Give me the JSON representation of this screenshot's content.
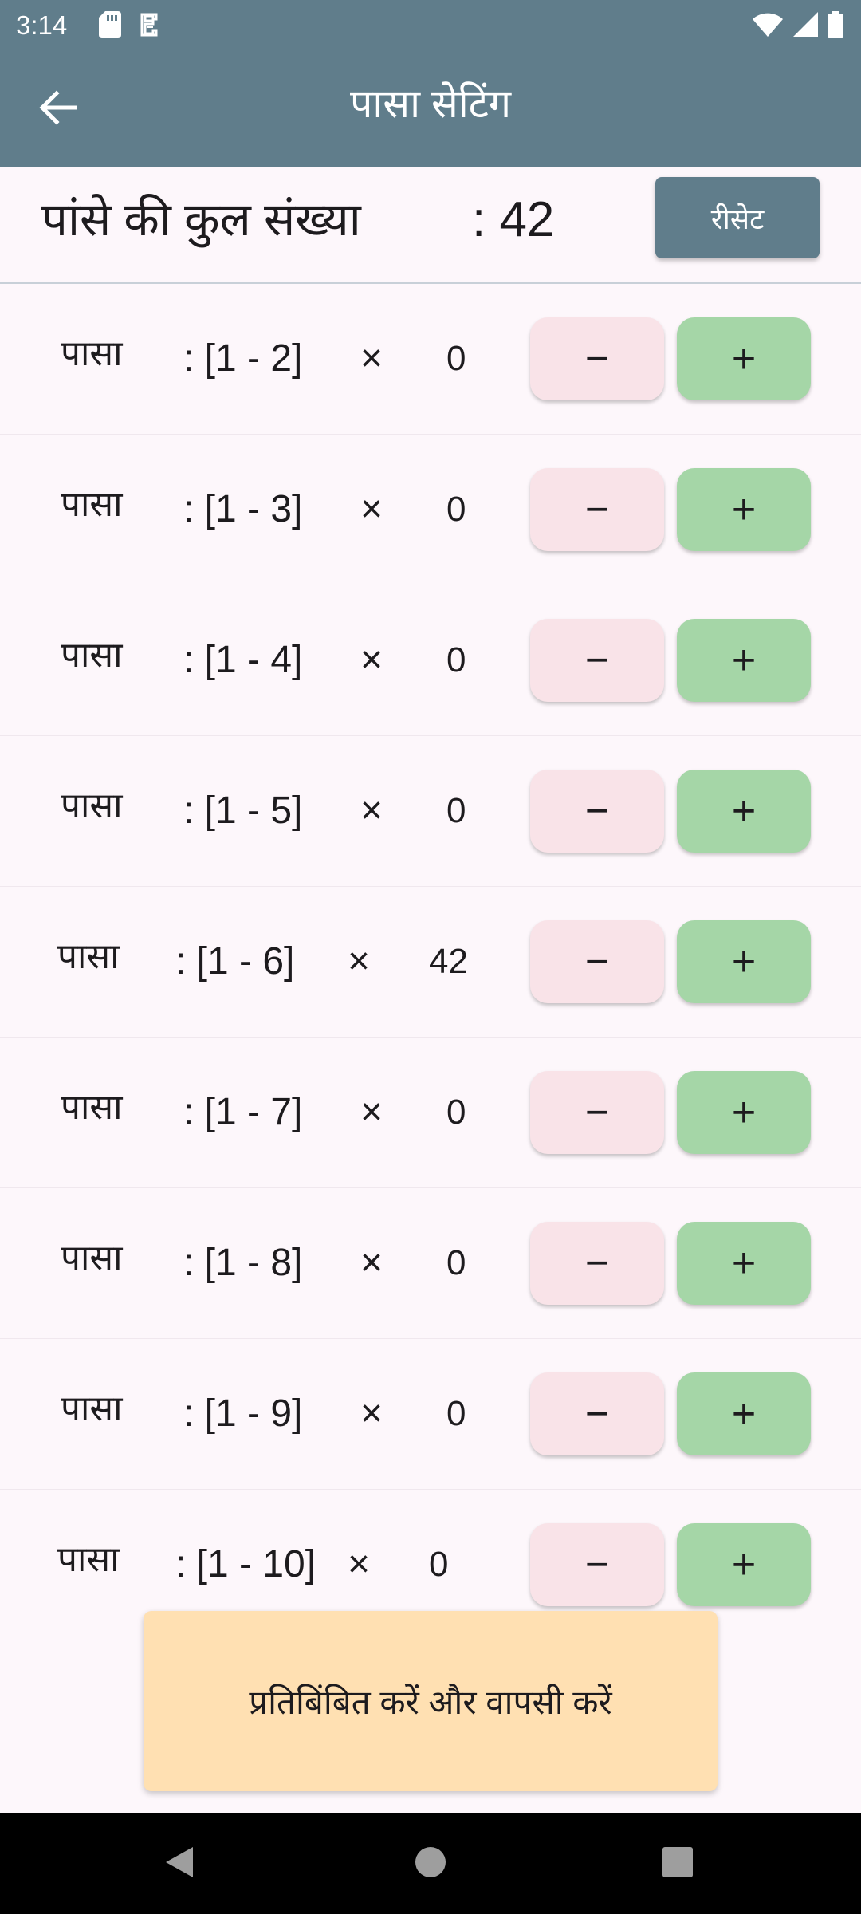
{
  "status_bar": {
    "time": "3:14",
    "icons": [
      "sd-card-icon",
      "notification-icon",
      "wifi-icon",
      "cellular-signal-icon",
      "battery-icon"
    ]
  },
  "app_bar": {
    "title": "पासा सेटिंग",
    "back_icon": "back-arrow-icon"
  },
  "header": {
    "total_label": "पांसे की कुल संख्या",
    "total_value": ": 42",
    "reset_label": "रीसेट"
  },
  "dice": [
    {
      "label": "पासा",
      "range": ": [1 - 2]",
      "times": "×",
      "count": "0",
      "minus": "−",
      "plus": "+"
    },
    {
      "label": "पासा",
      "range": ": [1 - 3]",
      "times": "×",
      "count": "0",
      "minus": "−",
      "plus": "+"
    },
    {
      "label": "पासा",
      "range": ": [1 - 4]",
      "times": "×",
      "count": "0",
      "minus": "−",
      "plus": "+"
    },
    {
      "label": "पासा",
      "range": ": [1 - 5]",
      "times": "×",
      "count": "0",
      "minus": "−",
      "plus": "+"
    },
    {
      "label": "पासा",
      "range": ": [1 - 6]",
      "times": "×",
      "count": "42",
      "minus": "−",
      "plus": "+"
    },
    {
      "label": "पासा",
      "range": ": [1 - 7]",
      "times": "×",
      "count": "0",
      "minus": "−",
      "plus": "+"
    },
    {
      "label": "पासा",
      "range": ": [1 - 8]",
      "times": "×",
      "count": "0",
      "minus": "−",
      "plus": "+"
    },
    {
      "label": "पासा",
      "range": ": [1 - 9]",
      "times": "×",
      "count": "0",
      "minus": "−",
      "plus": "+"
    },
    {
      "label": "पासा",
      "range": ": [1 - 10]",
      "times": "×",
      "count": "0",
      "minus": "−",
      "plus": "+"
    }
  ],
  "apply_button": {
    "label": "प्रतिबिंबित करें और वापसी करें"
  },
  "nav_bar": {
    "icons": [
      "nav-back-icon",
      "nav-home-icon",
      "nav-recents-icon"
    ]
  },
  "colors": {
    "app_bar": "#607d8b",
    "background": "#fdf7fb",
    "minus_button": "#f9e3e8",
    "plus_button": "#a5d6a7",
    "apply_button": "#ffe0b2"
  }
}
